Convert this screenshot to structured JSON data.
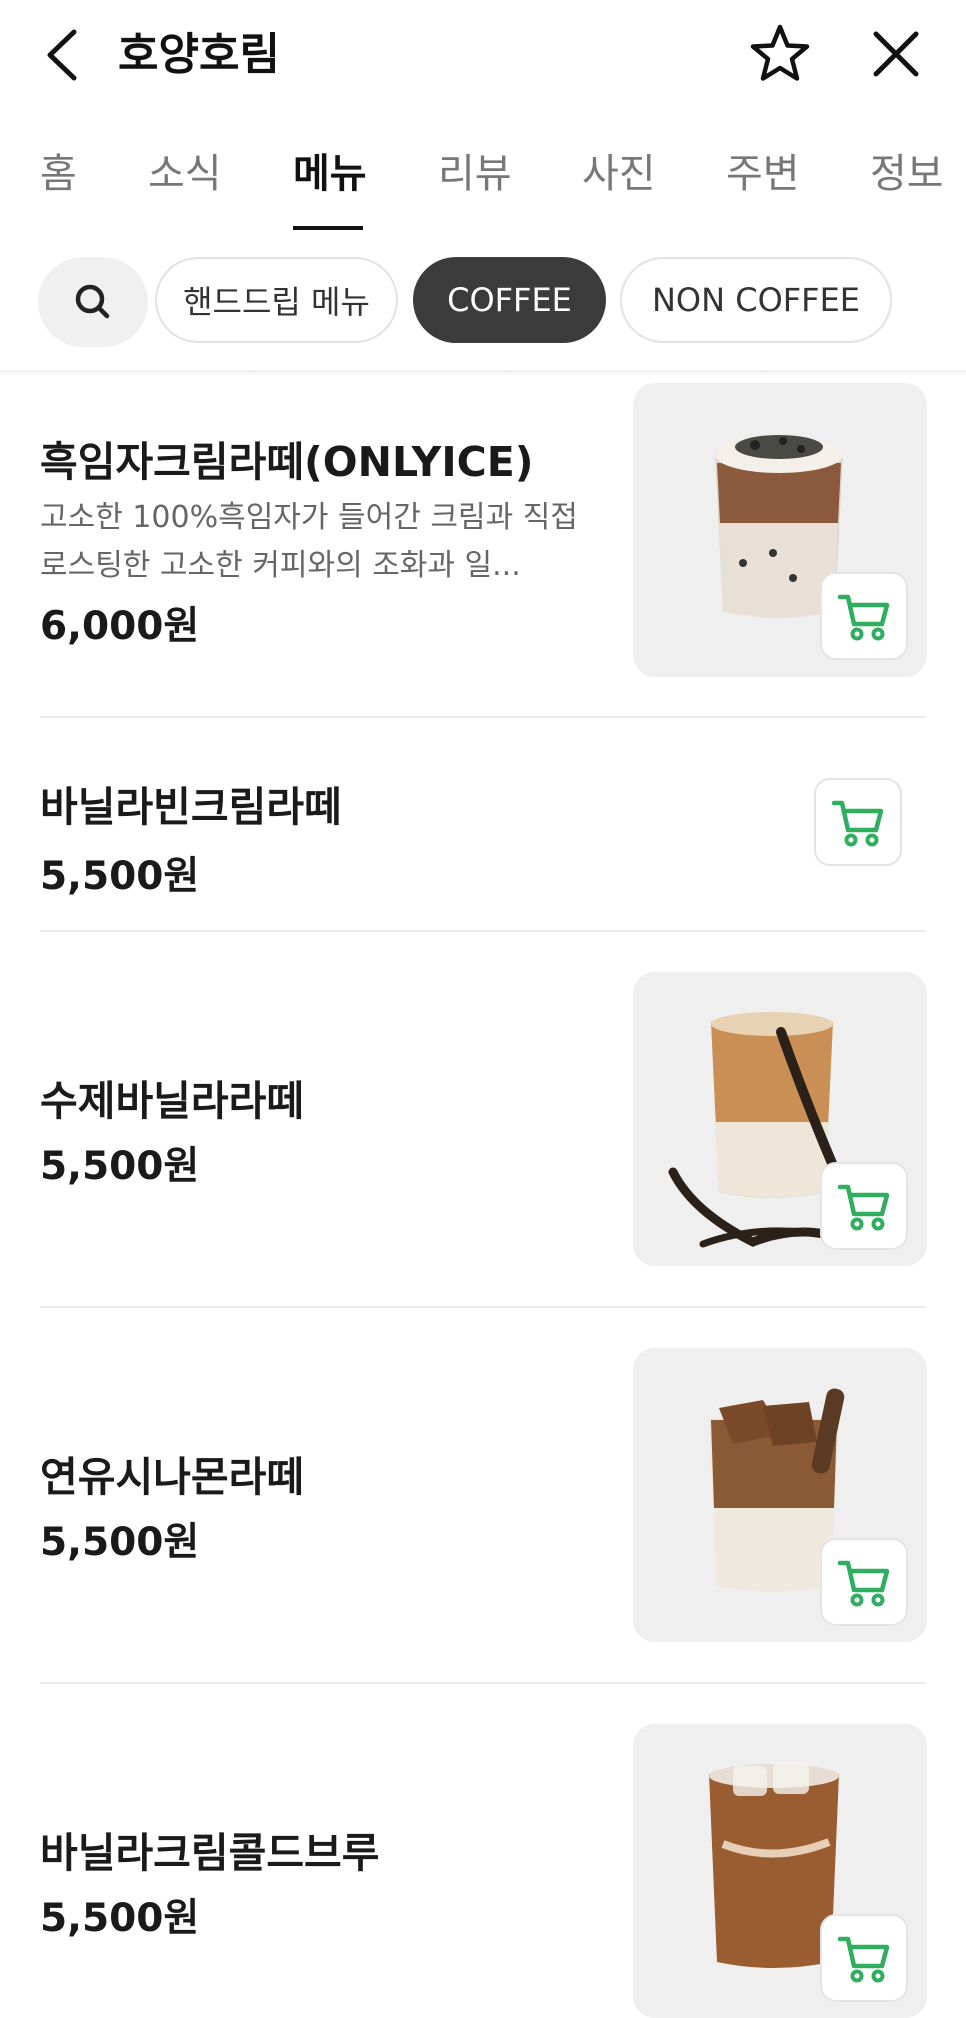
{
  "header": {
    "title": "호양호림"
  },
  "tabs": [
    "홈",
    "소식",
    "메뉴",
    "리뷰",
    "사진",
    "주변",
    "정보"
  ],
  "active_tab": "메뉴",
  "chips": [
    "핸드드립 메뉴",
    "COFFEE",
    "NON COFFEE"
  ],
  "selected_chip": "COFFEE",
  "menu_items": [
    {
      "name": "흑임자크림라떼(ONLYICE)",
      "description": "고소한 100%흑임자가 들어간 크림과 직접 로스팅한 고소한 커피와의 조화과 일...",
      "price": "6,000원",
      "image": "black-sesame-cream-latte-photo"
    },
    {
      "name": "바닐라빈크림라떼",
      "price": "5,500원"
    },
    {
      "name": "수제바닐라라떼",
      "price": "5,500원",
      "image": "vanilla-latte-photo"
    },
    {
      "name": "연유시나몬라떼",
      "price": "5,500원",
      "image": "condensed-milk-cinnamon-latte-photo"
    },
    {
      "name": "바닐라크림콜드브루",
      "price": "5,500원",
      "image": "vanilla-cream-cold-brew-photo"
    }
  ],
  "colors": {
    "accent_green": "#2fae5f",
    "selected_chip_bg": "#3b3b3b"
  }
}
